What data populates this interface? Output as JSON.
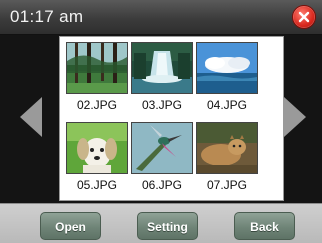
{
  "status_bar": {
    "time": "01:17 am",
    "close_icon": "close-icon",
    "close_color": "#d8281e"
  },
  "navigation": {
    "prev_icon": "chevron-left-icon",
    "next_icon": "chevron-right-icon"
  },
  "gallery": {
    "items": [
      {
        "filename": "02.JPG",
        "thumbnail": "forest"
      },
      {
        "filename": "03.JPG",
        "thumbnail": "waterfall"
      },
      {
        "filename": "04.JPG",
        "thumbnail": "clouds-sea"
      },
      {
        "filename": "05.JPG",
        "thumbnail": "puppy"
      },
      {
        "filename": "06.JPG",
        "thumbnail": "hummingbird"
      },
      {
        "filename": "07.JPG",
        "thumbnail": "cougar"
      }
    ]
  },
  "toolbar": {
    "open_label": "Open",
    "setting_label": "Setting",
    "back_label": "Back"
  }
}
